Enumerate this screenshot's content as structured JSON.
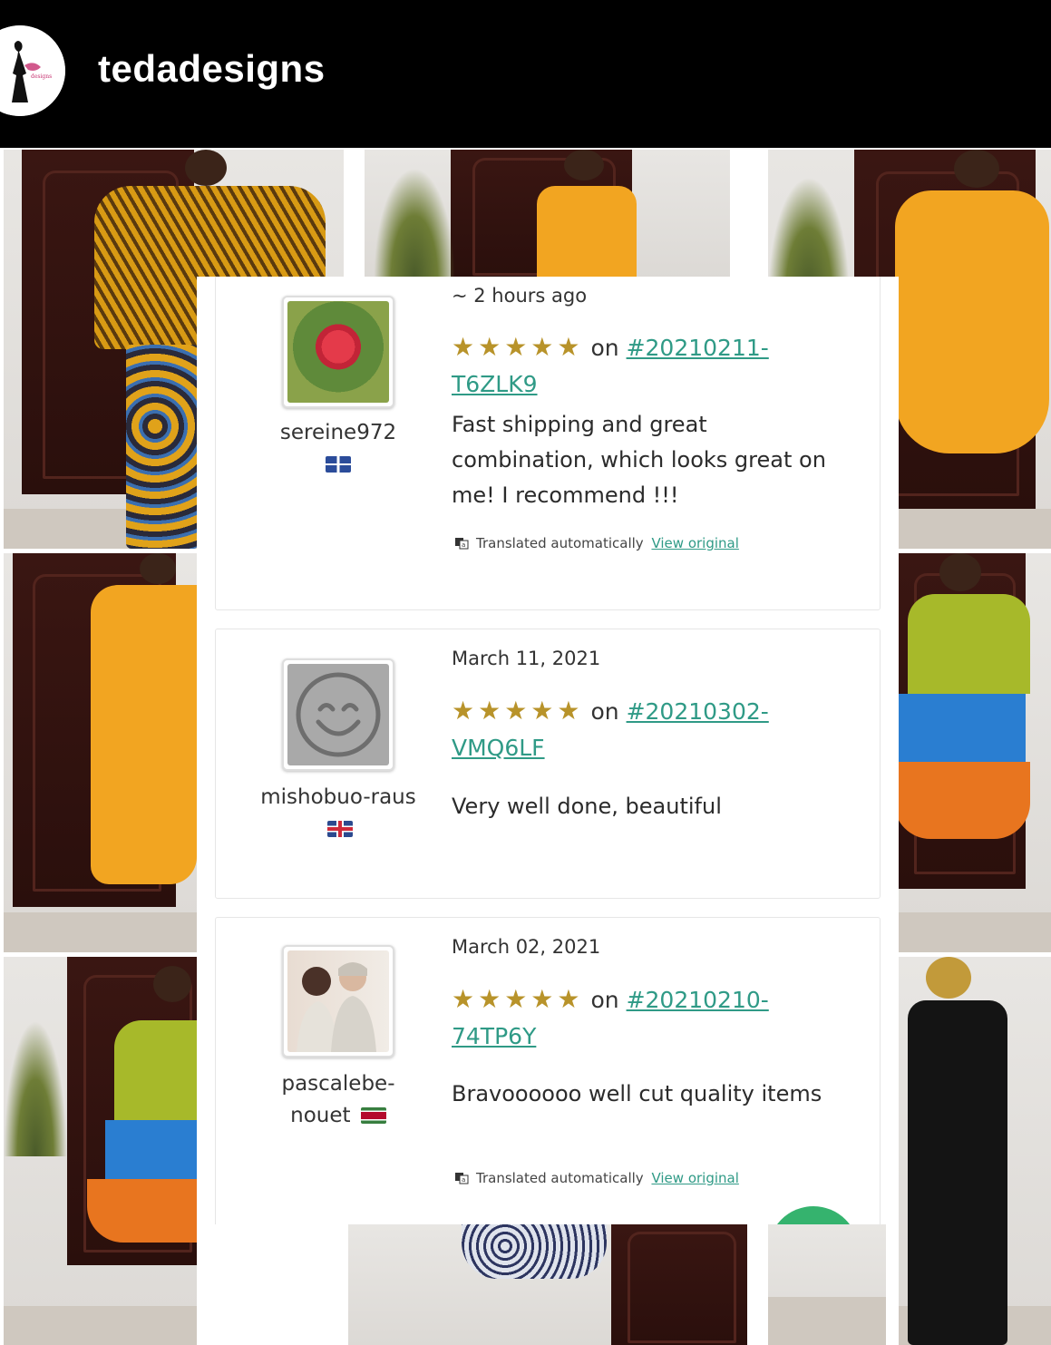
{
  "header": {
    "handle": "tedadesigns"
  },
  "reviews": [
    {
      "username": "sereine972",
      "flag": "martinique",
      "date": "~ 2 hours ago",
      "stars": "★★★★★",
      "on_label": "on",
      "order": "#20210211-T6ZLK9",
      "text": "Fast shipping and great combination, which looks great on me! I recommend !!!",
      "translated_label": "Translated automatically",
      "view_original_label": "View original"
    },
    {
      "username": "mishobuo-raus",
      "flag": "united-kingdom",
      "date": "March 11, 2021",
      "stars": "★★★★★",
      "on_label": "on",
      "order": "#20210302-VMQ6LF",
      "text": "Very well done, beautiful"
    },
    {
      "username": "pascalebe-nouet",
      "flag": "suriname",
      "date": "March 02, 2021",
      "stars": "★★★★★",
      "on_label": "on",
      "order": "#20210210-74TP6Y",
      "text": "Bravoooooo well cut quality items",
      "translated_label": "Translated automatically",
      "view_original_label": "View original"
    }
  ],
  "colors": {
    "star": "#b8932a",
    "link": "#2f9a86",
    "dress_yellow": "#f2a521",
    "dress_blue": "#2a7ed1",
    "dress_orange": "#e8751f",
    "dress_lime": "#a7b92a"
  }
}
